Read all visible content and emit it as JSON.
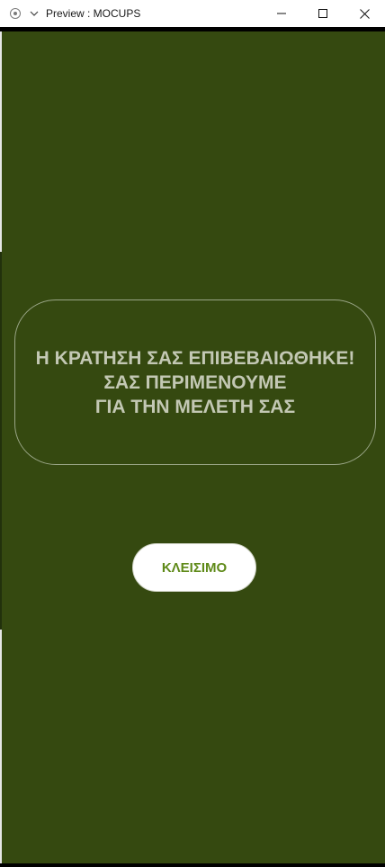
{
  "window": {
    "title": "Preview : MOCUPS",
    "icons": {
      "app": "radio-icon",
      "menu": "chevron-down-icon",
      "minimize": "minimize-icon",
      "maximize": "maximize-icon",
      "close": "close-icon"
    }
  },
  "screen": {
    "background_color": "#354910",
    "message": {
      "lines": [
        "Η ΚΡΑΤΗΣΗ ΣΑΣ ΕΠΙΒΕΒΑΙΩΘΗΚΕ!",
        "ΣΑΣ ΠΕΡΙΜΕΝΟΥΜΕ",
        "ΓΙΑ ΤΗΝ ΜΕΛΕΤΗ ΣΑΣ"
      ],
      "text_color": "#c3c8b4"
    },
    "close_button": {
      "label": "ΚΛΕΙΣΙΜΟ",
      "text_color": "#5f8a19"
    }
  }
}
